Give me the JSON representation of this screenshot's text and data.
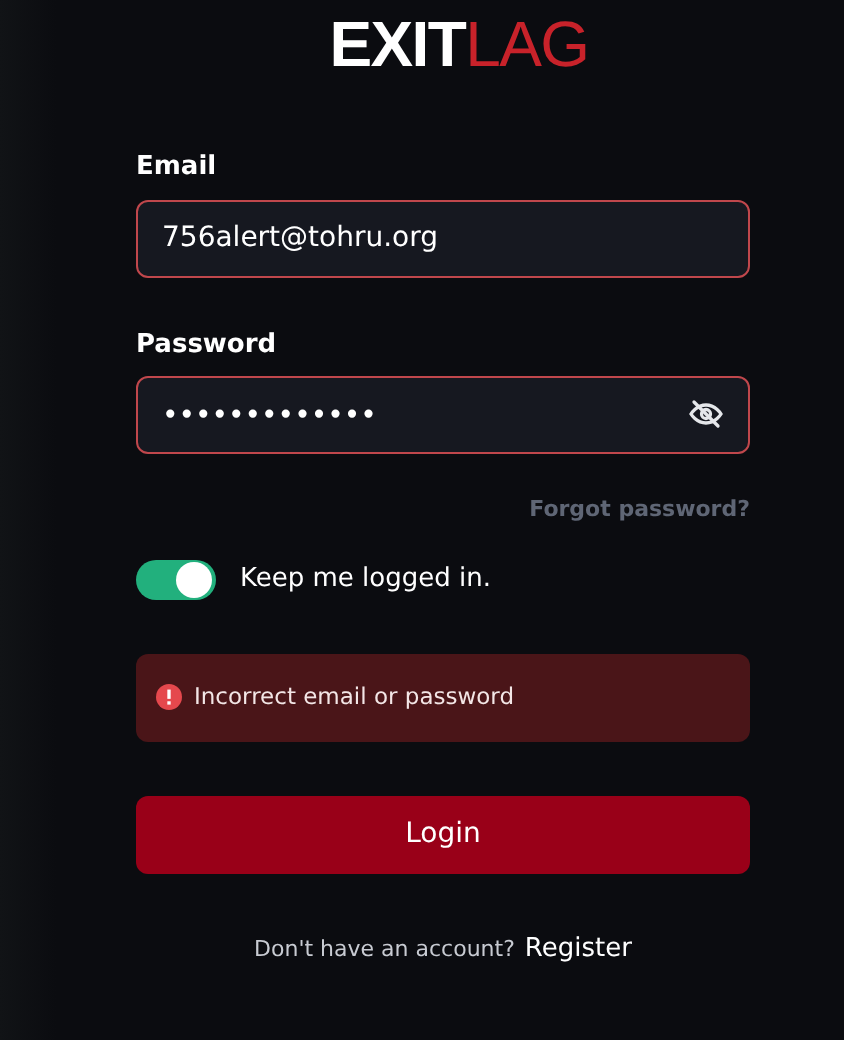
{
  "logo": {
    "primary": "EXIT",
    "accent": "LAG"
  },
  "email": {
    "label": "Email",
    "value": "756alert@tohru.org",
    "error": true
  },
  "password": {
    "label": "Password",
    "value": "•••••••••••••",
    "error": true
  },
  "forgot_link": "Forgot password?",
  "keep_logged_in": {
    "label": "Keep me logged in.",
    "on": true
  },
  "error_message": "Incorrect email or password",
  "login_button": "Login",
  "register": {
    "prompt": "Don't have an account?",
    "link": "Register"
  }
}
